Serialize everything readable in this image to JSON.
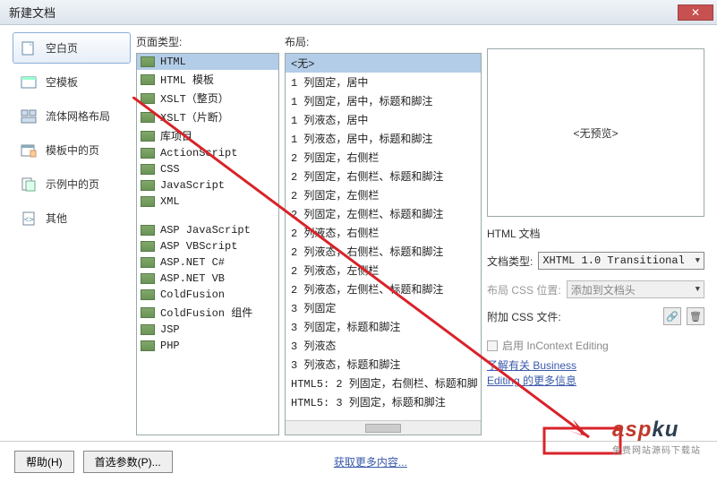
{
  "window": {
    "title": "新建文档"
  },
  "sidebar": {
    "items": [
      {
        "label": "空白页",
        "icon": "blank-page-icon",
        "selected": true
      },
      {
        "label": "空模板",
        "icon": "blank-template-icon"
      },
      {
        "label": "流体网格布局",
        "icon": "fluid-grid-icon"
      },
      {
        "label": "模板中的页",
        "icon": "page-from-template-icon"
      },
      {
        "label": "示例中的页",
        "icon": "page-from-sample-icon"
      },
      {
        "label": "其他",
        "icon": "other-icon"
      }
    ]
  },
  "columns": {
    "pagetype_header": "页面类型:",
    "layout_header": "布局:"
  },
  "pagetype": {
    "items": [
      "HTML",
      "HTML 模板",
      "XSLT（整页）",
      "XSLT（片断）",
      "库项目",
      "ActionScript",
      "CSS",
      "JavaScript",
      "XML"
    ],
    "items_group2": [
      "ASP JavaScript",
      "ASP VBScript",
      "ASP.NET C#",
      "ASP.NET VB",
      "ColdFusion",
      "ColdFusion 组件",
      "JSP",
      "PHP"
    ],
    "selected": "HTML"
  },
  "layout": {
    "items": [
      "<无>",
      "1 列固定，居中",
      "1 列固定，居中，标题和脚注",
      "1 列液态，居中",
      "1 列液态，居中，标题和脚注",
      "2 列固定，右侧栏",
      "2 列固定，右侧栏、标题和脚注",
      "2 列固定，左侧栏",
      "2 列固定，左侧栏、标题和脚注",
      "2 列液态，右侧栏",
      "2 列液态，右侧栏、标题和脚注",
      "2 列液态，左侧栏",
      "2 列液态，左侧栏、标题和脚注",
      "3 列固定",
      "3 列固定，标题和脚注",
      "3 列液态",
      "3 列液态，标题和脚注",
      "HTML5: 2 列固定，右侧栏、标题和脚",
      "HTML5: 3 列固定，标题和脚注"
    ],
    "selected": "<无>"
  },
  "preview": {
    "placeholder": "<无预览>",
    "description": "HTML 文档"
  },
  "doctype": {
    "label": "文档类型:",
    "value": "XHTML 1.0 Transitional"
  },
  "css_pos": {
    "label": "布局 CSS 位置:",
    "value": "添加到文档头"
  },
  "attach_css": {
    "label": "附加 CSS 文件:"
  },
  "incontext": {
    "checkbox_label": "启用 InContext Editing",
    "link1": "了解有关 Business",
    "link2": "Editing 的更多信息"
  },
  "buttons": {
    "help": "帮助(H)",
    "prefs": "首选参数(P)...",
    "more": "获取更多内容..."
  }
}
